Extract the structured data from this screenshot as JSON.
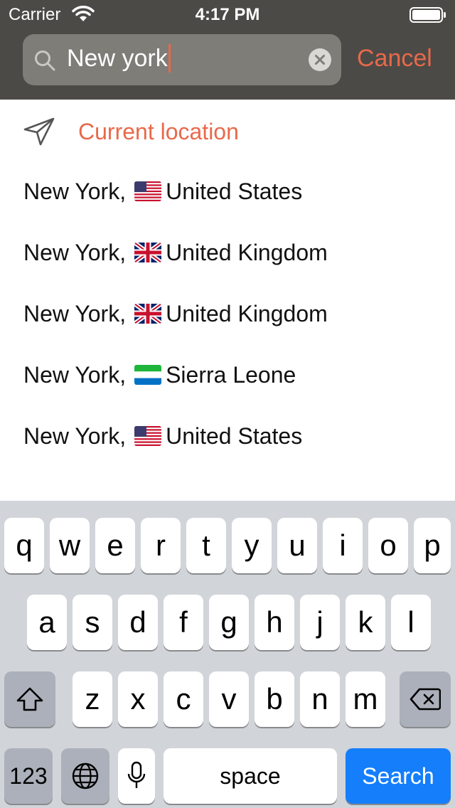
{
  "status_bar": {
    "carrier": "Carrier",
    "time": "4:17 PM"
  },
  "search": {
    "query": "New york",
    "cancel_label": "Cancel"
  },
  "current_location": {
    "label": "Current location",
    "icon": "location-arrow-icon"
  },
  "results": [
    {
      "city": "New York,",
      "flag": "us",
      "country": "United States"
    },
    {
      "city": "New York,",
      "flag": "gb",
      "country": "United Kingdom"
    },
    {
      "city": "New York,",
      "flag": "gb",
      "country": "United Kingdom"
    },
    {
      "city": "New York,",
      "flag": "sl",
      "country": "Sierra Leone"
    },
    {
      "city": "New York,",
      "flag": "us",
      "country": "United States"
    }
  ],
  "keyboard": {
    "row1": [
      "q",
      "w",
      "e",
      "r",
      "t",
      "y",
      "u",
      "i",
      "o",
      "p"
    ],
    "row2": [
      "a",
      "s",
      "d",
      "f",
      "g",
      "h",
      "j",
      "k",
      "l"
    ],
    "row3": [
      "z",
      "x",
      "c",
      "v",
      "b",
      "n",
      "m"
    ],
    "numbers_label": "123",
    "space_label": "space",
    "search_label": "Search"
  },
  "colors": {
    "accent": "#e8694a",
    "header_bg": "#4b4a46",
    "search_key": "#147efb",
    "keyboard_bg": "#d1d4d9"
  }
}
